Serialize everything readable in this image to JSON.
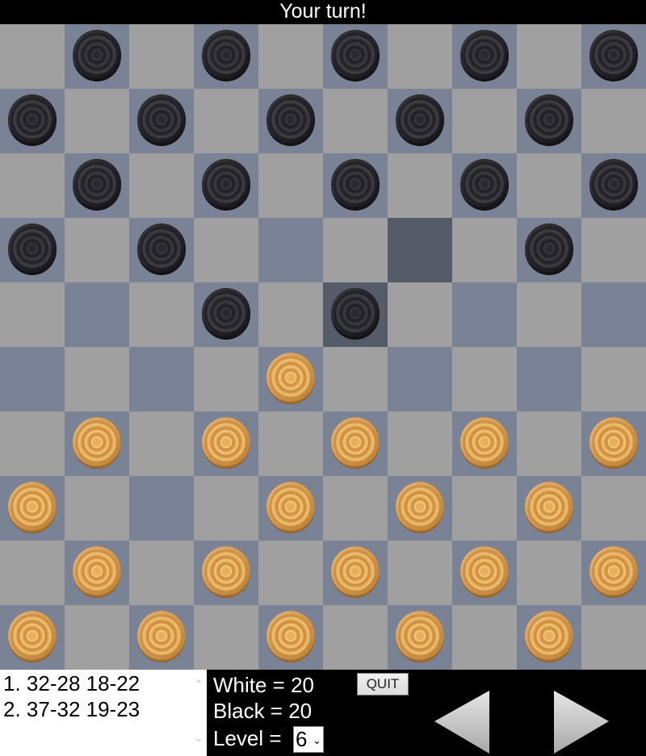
{
  "status": "Your turn!",
  "colors": {
    "light_square": "#a0a0a0",
    "dark_square": "#7a8296",
    "highlight_square": "#555b68"
  },
  "board": {
    "size": 10,
    "highlighted": [
      [
        3,
        6
      ],
      [
        4,
        5
      ]
    ],
    "black_pieces": [
      [
        0,
        1
      ],
      [
        0,
        3
      ],
      [
        0,
        5
      ],
      [
        0,
        7
      ],
      [
        0,
        9
      ],
      [
        1,
        0
      ],
      [
        1,
        2
      ],
      [
        1,
        4
      ],
      [
        1,
        6
      ],
      [
        1,
        8
      ],
      [
        2,
        1
      ],
      [
        2,
        3
      ],
      [
        2,
        5
      ],
      [
        2,
        7
      ],
      [
        2,
        9
      ],
      [
        3,
        0
      ],
      [
        3,
        2
      ],
      [
        3,
        8
      ],
      [
        4,
        3
      ],
      [
        4,
        5
      ]
    ],
    "white_pieces": [
      [
        5,
        4
      ],
      [
        6,
        1
      ],
      [
        6,
        3
      ],
      [
        6,
        5
      ],
      [
        6,
        7
      ],
      [
        6,
        9
      ],
      [
        7,
        0
      ],
      [
        7,
        4
      ],
      [
        7,
        6
      ],
      [
        7,
        8
      ],
      [
        8,
        1
      ],
      [
        8,
        3
      ],
      [
        8,
        5
      ],
      [
        8,
        7
      ],
      [
        8,
        9
      ],
      [
        9,
        0
      ],
      [
        9,
        2
      ],
      [
        9,
        4
      ],
      [
        9,
        6
      ],
      [
        9,
        8
      ]
    ]
  },
  "moves": [
    "1. 32-28 18-22",
    "2. 37-32 19-23"
  ],
  "scores": {
    "white": "White = 20",
    "black": "Black = 20",
    "level_label": "Level = ",
    "level_value": "6"
  },
  "controls": {
    "quit": "QUIT",
    "scroll_up": "^",
    "scroll_down": "v",
    "level_chevron": "⌄"
  }
}
